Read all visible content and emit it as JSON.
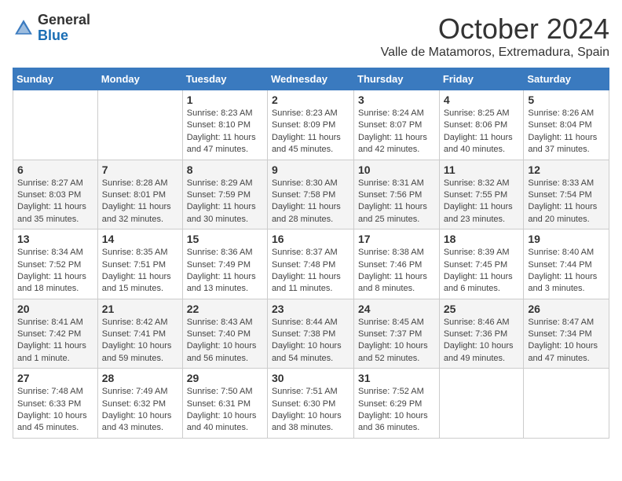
{
  "logo": {
    "general": "General",
    "blue": "Blue"
  },
  "header": {
    "month": "October 2024",
    "location": "Valle de Matamoros, Extremadura, Spain"
  },
  "weekdays": [
    "Sunday",
    "Monday",
    "Tuesday",
    "Wednesday",
    "Thursday",
    "Friday",
    "Saturday"
  ],
  "weeks": [
    [
      {
        "day": "",
        "sunrise": "",
        "sunset": "",
        "daylight": ""
      },
      {
        "day": "",
        "sunrise": "",
        "sunset": "",
        "daylight": ""
      },
      {
        "day": "1",
        "sunrise": "Sunrise: 8:23 AM",
        "sunset": "Sunset: 8:10 PM",
        "daylight": "Daylight: 11 hours and 47 minutes."
      },
      {
        "day": "2",
        "sunrise": "Sunrise: 8:23 AM",
        "sunset": "Sunset: 8:09 PM",
        "daylight": "Daylight: 11 hours and 45 minutes."
      },
      {
        "day": "3",
        "sunrise": "Sunrise: 8:24 AM",
        "sunset": "Sunset: 8:07 PM",
        "daylight": "Daylight: 11 hours and 42 minutes."
      },
      {
        "day": "4",
        "sunrise": "Sunrise: 8:25 AM",
        "sunset": "Sunset: 8:06 PM",
        "daylight": "Daylight: 11 hours and 40 minutes."
      },
      {
        "day": "5",
        "sunrise": "Sunrise: 8:26 AM",
        "sunset": "Sunset: 8:04 PM",
        "daylight": "Daylight: 11 hours and 37 minutes."
      }
    ],
    [
      {
        "day": "6",
        "sunrise": "Sunrise: 8:27 AM",
        "sunset": "Sunset: 8:03 PM",
        "daylight": "Daylight: 11 hours and 35 minutes."
      },
      {
        "day": "7",
        "sunrise": "Sunrise: 8:28 AM",
        "sunset": "Sunset: 8:01 PM",
        "daylight": "Daylight: 11 hours and 32 minutes."
      },
      {
        "day": "8",
        "sunrise": "Sunrise: 8:29 AM",
        "sunset": "Sunset: 7:59 PM",
        "daylight": "Daylight: 11 hours and 30 minutes."
      },
      {
        "day": "9",
        "sunrise": "Sunrise: 8:30 AM",
        "sunset": "Sunset: 7:58 PM",
        "daylight": "Daylight: 11 hours and 28 minutes."
      },
      {
        "day": "10",
        "sunrise": "Sunrise: 8:31 AM",
        "sunset": "Sunset: 7:56 PM",
        "daylight": "Daylight: 11 hours and 25 minutes."
      },
      {
        "day": "11",
        "sunrise": "Sunrise: 8:32 AM",
        "sunset": "Sunset: 7:55 PM",
        "daylight": "Daylight: 11 hours and 23 minutes."
      },
      {
        "day": "12",
        "sunrise": "Sunrise: 8:33 AM",
        "sunset": "Sunset: 7:54 PM",
        "daylight": "Daylight: 11 hours and 20 minutes."
      }
    ],
    [
      {
        "day": "13",
        "sunrise": "Sunrise: 8:34 AM",
        "sunset": "Sunset: 7:52 PM",
        "daylight": "Daylight: 11 hours and 18 minutes."
      },
      {
        "day": "14",
        "sunrise": "Sunrise: 8:35 AM",
        "sunset": "Sunset: 7:51 PM",
        "daylight": "Daylight: 11 hours and 15 minutes."
      },
      {
        "day": "15",
        "sunrise": "Sunrise: 8:36 AM",
        "sunset": "Sunset: 7:49 PM",
        "daylight": "Daylight: 11 hours and 13 minutes."
      },
      {
        "day": "16",
        "sunrise": "Sunrise: 8:37 AM",
        "sunset": "Sunset: 7:48 PM",
        "daylight": "Daylight: 11 hours and 11 minutes."
      },
      {
        "day": "17",
        "sunrise": "Sunrise: 8:38 AM",
        "sunset": "Sunset: 7:46 PM",
        "daylight": "Daylight: 11 hours and 8 minutes."
      },
      {
        "day": "18",
        "sunrise": "Sunrise: 8:39 AM",
        "sunset": "Sunset: 7:45 PM",
        "daylight": "Daylight: 11 hours and 6 minutes."
      },
      {
        "day": "19",
        "sunrise": "Sunrise: 8:40 AM",
        "sunset": "Sunset: 7:44 PM",
        "daylight": "Daylight: 11 hours and 3 minutes."
      }
    ],
    [
      {
        "day": "20",
        "sunrise": "Sunrise: 8:41 AM",
        "sunset": "Sunset: 7:42 PM",
        "daylight": "Daylight: 11 hours and 1 minute."
      },
      {
        "day": "21",
        "sunrise": "Sunrise: 8:42 AM",
        "sunset": "Sunset: 7:41 PM",
        "daylight": "Daylight: 10 hours and 59 minutes."
      },
      {
        "day": "22",
        "sunrise": "Sunrise: 8:43 AM",
        "sunset": "Sunset: 7:40 PM",
        "daylight": "Daylight: 10 hours and 56 minutes."
      },
      {
        "day": "23",
        "sunrise": "Sunrise: 8:44 AM",
        "sunset": "Sunset: 7:38 PM",
        "daylight": "Daylight: 10 hours and 54 minutes."
      },
      {
        "day": "24",
        "sunrise": "Sunrise: 8:45 AM",
        "sunset": "Sunset: 7:37 PM",
        "daylight": "Daylight: 10 hours and 52 minutes."
      },
      {
        "day": "25",
        "sunrise": "Sunrise: 8:46 AM",
        "sunset": "Sunset: 7:36 PM",
        "daylight": "Daylight: 10 hours and 49 minutes."
      },
      {
        "day": "26",
        "sunrise": "Sunrise: 8:47 AM",
        "sunset": "Sunset: 7:34 PM",
        "daylight": "Daylight: 10 hours and 47 minutes."
      }
    ],
    [
      {
        "day": "27",
        "sunrise": "Sunrise: 7:48 AM",
        "sunset": "Sunset: 6:33 PM",
        "daylight": "Daylight: 10 hours and 45 minutes."
      },
      {
        "day": "28",
        "sunrise": "Sunrise: 7:49 AM",
        "sunset": "Sunset: 6:32 PM",
        "daylight": "Daylight: 10 hours and 43 minutes."
      },
      {
        "day": "29",
        "sunrise": "Sunrise: 7:50 AM",
        "sunset": "Sunset: 6:31 PM",
        "daylight": "Daylight: 10 hours and 40 minutes."
      },
      {
        "day": "30",
        "sunrise": "Sunrise: 7:51 AM",
        "sunset": "Sunset: 6:30 PM",
        "daylight": "Daylight: 10 hours and 38 minutes."
      },
      {
        "day": "31",
        "sunrise": "Sunrise: 7:52 AM",
        "sunset": "Sunset: 6:29 PM",
        "daylight": "Daylight: 10 hours and 36 minutes."
      },
      {
        "day": "",
        "sunrise": "",
        "sunset": "",
        "daylight": ""
      },
      {
        "day": "",
        "sunrise": "",
        "sunset": "",
        "daylight": ""
      }
    ]
  ]
}
